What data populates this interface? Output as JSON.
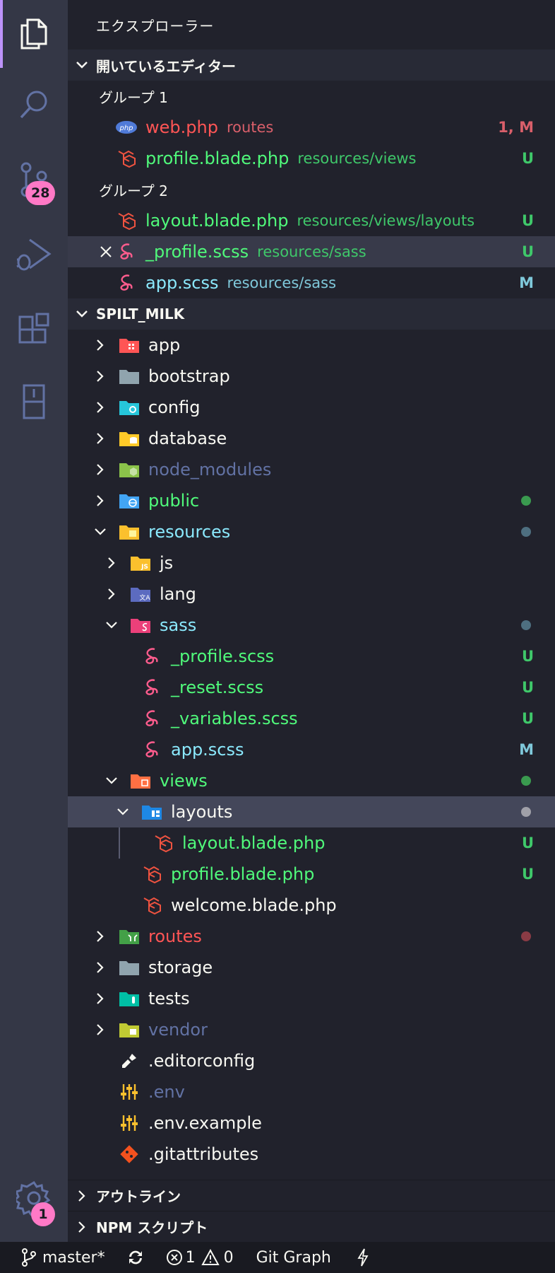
{
  "sidebar": {
    "title": "エクスプローラー"
  },
  "open_editors": {
    "header": "開いているエディター",
    "group1_label": "グループ 1",
    "group2_label": "グループ 2",
    "items": [
      {
        "name": "web.php",
        "desc": "routes",
        "status": "1, M",
        "icon": "php-icon"
      },
      {
        "name": "profile.blade.php",
        "desc": "resources/views",
        "status": "U",
        "icon": "laravel-icon"
      },
      {
        "name": "layout.blade.php",
        "desc": "resources/views/layouts",
        "status": "U",
        "icon": "laravel-icon"
      },
      {
        "name": "_profile.scss",
        "desc": "resources/sass",
        "status": "U",
        "icon": "sass-icon"
      },
      {
        "name": "app.scss",
        "desc": "resources/sass",
        "status": "M",
        "icon": "sass-icon"
      }
    ]
  },
  "project": {
    "header": "SPILT_MILK",
    "tree": [
      {
        "name": "app",
        "icon": "folder-app-icon"
      },
      {
        "name": "bootstrap",
        "icon": "folder-icon"
      },
      {
        "name": "config",
        "icon": "folder-config-icon"
      },
      {
        "name": "database",
        "icon": "folder-database-icon"
      },
      {
        "name": "node_modules",
        "icon": "folder-node-icon"
      },
      {
        "name": "public",
        "icon": "folder-public-icon"
      },
      {
        "name": "resources",
        "icon": "folder-resources-open-icon"
      },
      {
        "name": "js",
        "icon": "folder-js-icon"
      },
      {
        "name": "lang",
        "icon": "folder-lang-icon"
      },
      {
        "name": "sass",
        "icon": "folder-sass-open-icon"
      },
      {
        "name": "_profile.scss",
        "status": "U",
        "icon": "sass-icon"
      },
      {
        "name": "_reset.scss",
        "status": "U",
        "icon": "sass-icon"
      },
      {
        "name": "_variables.scss",
        "status": "U",
        "icon": "sass-icon"
      },
      {
        "name": "app.scss",
        "status": "M",
        "icon": "sass-icon"
      },
      {
        "name": "views",
        "icon": "folder-views-open-icon"
      },
      {
        "name": "layouts",
        "icon": "folder-layouts-open-icon"
      },
      {
        "name": "layout.blade.php",
        "status": "U",
        "icon": "laravel-icon"
      },
      {
        "name": "profile.blade.php",
        "status": "U",
        "icon": "laravel-icon"
      },
      {
        "name": "welcome.blade.php",
        "icon": "laravel-icon"
      },
      {
        "name": "routes",
        "icon": "folder-routes-icon"
      },
      {
        "name": "storage",
        "icon": "folder-icon"
      },
      {
        "name": "tests",
        "icon": "folder-tests-icon"
      },
      {
        "name": "vendor",
        "icon": "folder-vendor-icon"
      },
      {
        "name": ".editorconfig",
        "icon": "editorconfig-icon"
      },
      {
        "name": ".env",
        "icon": "env-icon"
      },
      {
        "name": ".env.example",
        "icon": "env-icon"
      },
      {
        "name": ".gitattributes",
        "icon": "git-icon"
      }
    ]
  },
  "panels": {
    "outline": "アウトライン",
    "npm_scripts": "NPM スクリプト"
  },
  "activity_bar": {
    "scm_badge": "28",
    "settings_badge": "1"
  },
  "status_bar": {
    "branch": "master*",
    "errors": "1",
    "warnings": "0",
    "git_graph": "Git Graph"
  },
  "colors": {
    "added": "#50fa7b",
    "modified": "#8be9fd",
    "error": "#ff5555",
    "ignored": "#6272a4",
    "badge": "#ff79c6"
  }
}
